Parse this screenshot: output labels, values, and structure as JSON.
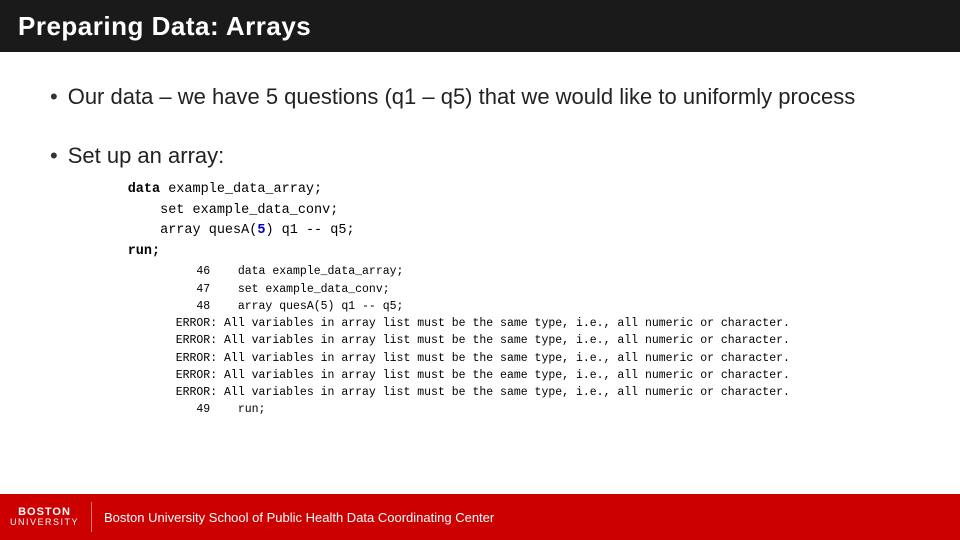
{
  "header": {
    "title": "Preparing Data: Arrays"
  },
  "bullets": [
    {
      "id": "bullet1",
      "text": "Our data – we have 5 questions (q1 – q5) that we would like to uniformly process"
    },
    {
      "id": "bullet2",
      "text": "Set up an array:"
    }
  ],
  "code": {
    "lines": [
      {
        "indent": 0,
        "content": "data example_data_array;",
        "bold_start": "data"
      },
      {
        "indent": 4,
        "content": "set example_data_conv;"
      },
      {
        "indent": 4,
        "content": "array quesA(5) q1 -- q5;"
      },
      {
        "indent": 0,
        "content": "run;",
        "bold_start": "run"
      }
    ],
    "output": [
      "   46    data example_data_array;",
      "   47    set example_data_conv;",
      "   48    array quesA(5) q1 -- q5;",
      "ERROR: All variables in array list must be the same type, i.e., all numeric or character.",
      "ERROR: All variables in array list must be the same type, i.e., all numeric or character.",
      "ERROR: All variables in array list must be the same type, i.e., all numeric or character.",
      "ERROR: All variables in array list must be the eame type, i.e., all numeric or character.",
      "ERROR: All variables in array list must be the same type, i.e., all numeric or character.",
      "   49    run;"
    ]
  },
  "footer": {
    "logo_top": "BOSTON",
    "logo_bottom": "UNIVERSITY",
    "text": "Boston University School of Public Health Data Coordinating Center"
  }
}
